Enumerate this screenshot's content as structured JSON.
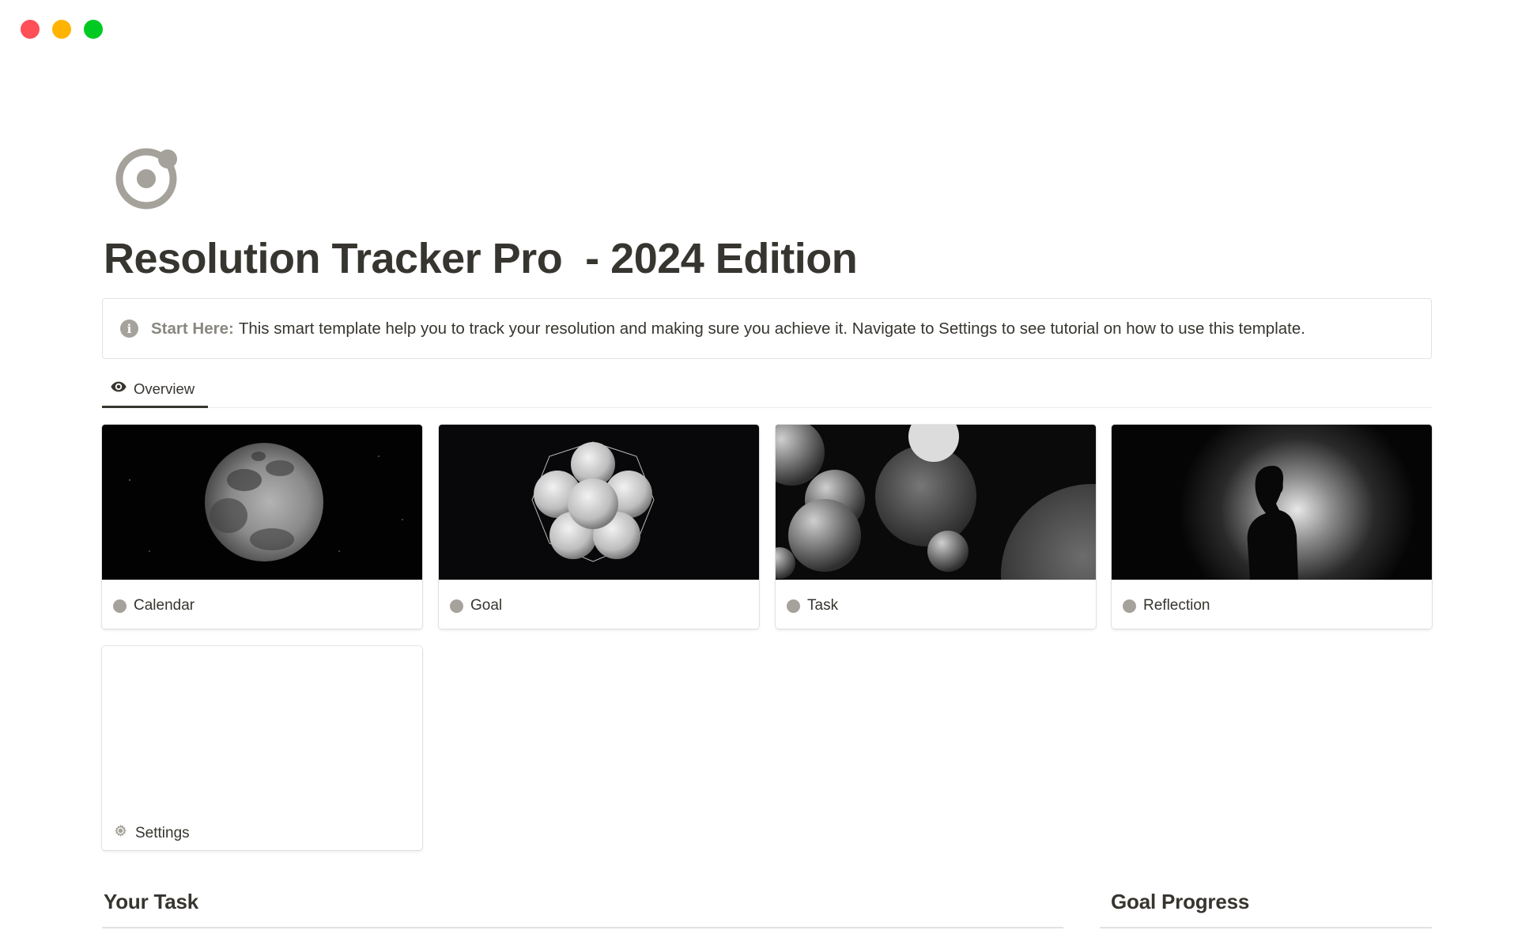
{
  "window": {
    "controls": [
      "close",
      "minimize",
      "maximize"
    ],
    "colors": {
      "close": "#ff4f57",
      "minimize": "#ffb302",
      "maximize": "#00c922"
    }
  },
  "page": {
    "icon": "target-icon",
    "title": "Resolution Tracker Pro  - 2024 Edition"
  },
  "callout": {
    "icon": "info-icon",
    "icon_glyph": "i",
    "lead": "Start Here:",
    "text": "This smart template help you to track your resolution and making sure you achieve it. Navigate to Settings to see tutorial on how to use this template."
  },
  "tabs": [
    {
      "label": "Overview",
      "icon": "eye-icon",
      "active": true
    }
  ],
  "gallery": {
    "cards": [
      {
        "label": "Calendar",
        "icon": "dot-icon",
        "cover": "moon"
      },
      {
        "label": "Goal",
        "icon": "dot-icon",
        "cover": "spheres-in-wireframe"
      },
      {
        "label": "Task",
        "icon": "dot-icon",
        "cover": "floating-spheres"
      },
      {
        "label": "Reflection",
        "icon": "dot-icon",
        "cover": "silhouette"
      },
      {
        "label": "Settings",
        "icon": "gear-icon",
        "cover": "none"
      }
    ]
  },
  "sections": {
    "your_task": "Your Task",
    "goal_progress": "Goal Progress"
  }
}
